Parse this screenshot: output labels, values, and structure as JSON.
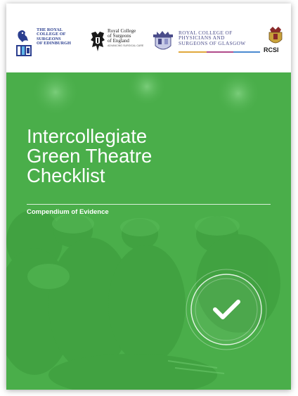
{
  "header": {
    "logos": [
      {
        "name": "rcsed",
        "lines": [
          "THE ROYAL",
          "COLLEGE OF",
          "SURGEONS",
          "OF EDINBURGH"
        ]
      },
      {
        "name": "rcseng",
        "lines": [
          "Royal College",
          "of Surgeons",
          "of England"
        ],
        "tagline": "ADVANCING SURGICAL CARE"
      },
      {
        "name": "rcpsg",
        "lines": [
          "ROYAL COLLEGE OF",
          "PHYSICIANS AND",
          "SURGEONS OF GLASGOW"
        ]
      },
      {
        "name": "rcsi",
        "lines": [
          "RCSI"
        ]
      }
    ]
  },
  "cover": {
    "title_lines": [
      "Intercollegiate",
      "Green Theatre",
      "Checklist"
    ],
    "subtitle": "Compendium of Evidence",
    "background_color": "#4aae4a",
    "check_icon": "checkmark-circle-icon"
  }
}
